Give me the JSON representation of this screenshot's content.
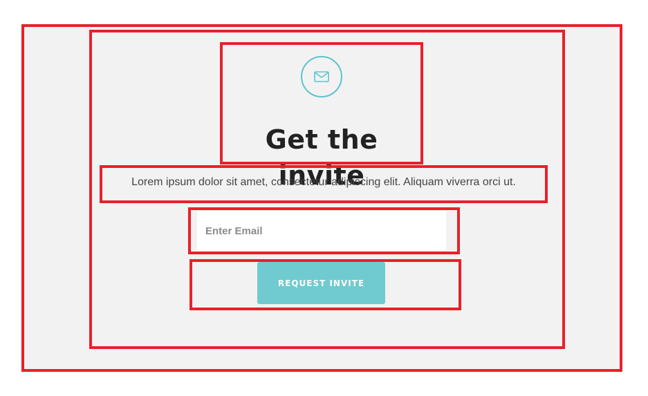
{
  "header": {
    "icon": "envelope-icon",
    "title": "Get the invite"
  },
  "description": "Lorem ipsum dolor sit amet, consectetur adipiscing elit. Aliquam viverra orci ut.",
  "form": {
    "email_placeholder": "Enter Email",
    "email_value": "",
    "submit_label": "REQUEST INVITE"
  },
  "colors": {
    "accent": "#6fcbcf",
    "highlight_border": "#e8202a",
    "panel_background": "#f2f2f2",
    "title_text": "#222222"
  }
}
